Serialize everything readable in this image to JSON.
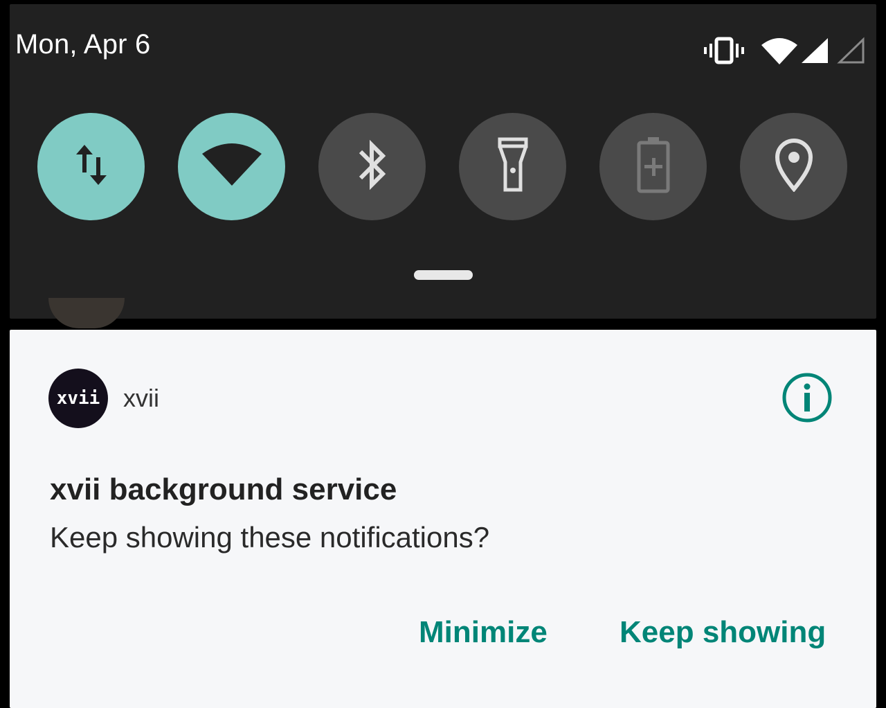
{
  "status_bar": {
    "date": "Mon, Apr 6",
    "icons": [
      "vibrate-icon",
      "wifi-signal-icon",
      "cell-signal-icon",
      "cell-signal-empty-icon"
    ]
  },
  "quick_settings": {
    "tiles": [
      {
        "name": "mobile-data",
        "icon": "data-transfer-icon",
        "state": "on"
      },
      {
        "name": "wifi",
        "icon": "wifi-icon",
        "state": "on"
      },
      {
        "name": "bluetooth",
        "icon": "bluetooth-icon",
        "state": "off"
      },
      {
        "name": "flashlight",
        "icon": "flashlight-icon",
        "state": "off"
      },
      {
        "name": "battery-saver",
        "icon": "battery-saver-icon",
        "state": "off"
      },
      {
        "name": "location",
        "icon": "location-pin-icon",
        "state": "off"
      }
    ],
    "active_color": "#80cbc4",
    "inactive_color": "#4a4a4a"
  },
  "notification": {
    "app_icon_text": "xvii",
    "app_name": "xvii",
    "title": "xvii background service",
    "text": "Keep showing these notifications?",
    "actions": {
      "minimize": "Minimize",
      "keep_showing": "Keep showing"
    },
    "accent_color": "#008577"
  }
}
